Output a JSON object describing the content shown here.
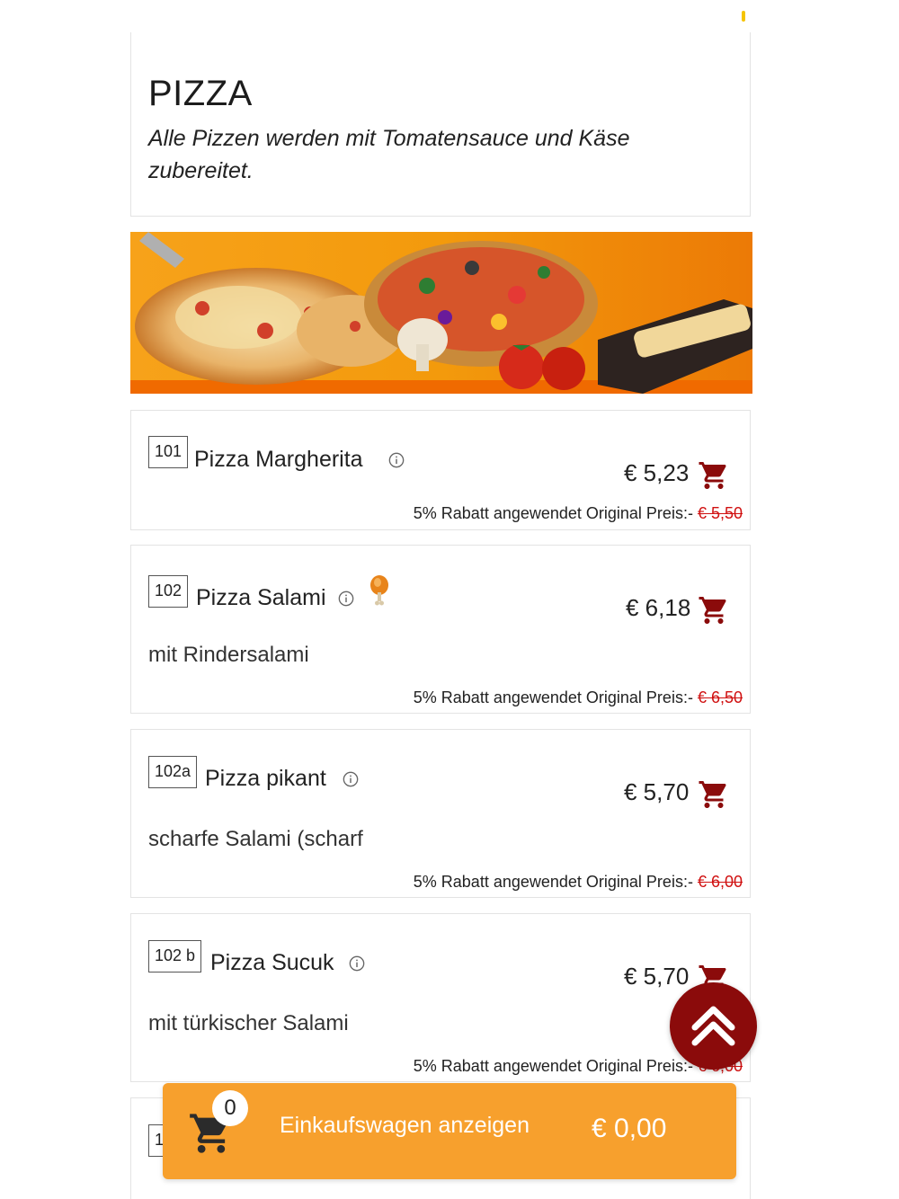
{
  "category": {
    "title": "PIZZA",
    "description": "Alle Pizzen werden mit Tomatensauce und Käse zubereitet."
  },
  "banner": {
    "image": "pizza-banner",
    "colors": {
      "background": "#f39a0c",
      "accent": "#e86c00"
    }
  },
  "items": [
    {
      "number": "101",
      "name": "Pizza Margherita",
      "price": "€ 5,23",
      "description": "",
      "discount_text": "5% Rabatt angewendet Original Preis:-",
      "original_price": "€ 5,50"
    },
    {
      "number": "102",
      "name": "Pizza Salami",
      "price": "€ 6,18",
      "description": "mit Rindersalami",
      "discount_text": "5% Rabatt angewendet Original Preis:-",
      "original_price": "€ 6,50",
      "badge_icon": "chicken-leg-icon"
    },
    {
      "number": "102a",
      "name": "Pizza pikant",
      "price": "€ 5,70",
      "description": "scharfe Salami (scharf",
      "discount_text": "5% Rabatt angewendet Original Preis:-",
      "original_price": "€ 6,00"
    },
    {
      "number": "102 b",
      "name": "Pizza Sucuk",
      "price": "€ 5,70",
      "description": "mit türkischer Salami",
      "discount_text": "5% Rabatt angewendet Original Preis:-",
      "original_price": "€ 6,00"
    },
    {
      "number": "1"
    }
  ],
  "cart_bar": {
    "count": "0",
    "label": "Einkaufswagen anzeigen",
    "total": "€ 0,00"
  },
  "colors": {
    "cart_bar": "#f7a02d",
    "cart_icon": "#8b0b0b",
    "scroll_top": "#8b0b0b",
    "strike_price": "#d01010"
  },
  "icons": {
    "info": "info-icon",
    "cart": "cart-icon",
    "scroll_top": "double-chevron-up-icon"
  }
}
